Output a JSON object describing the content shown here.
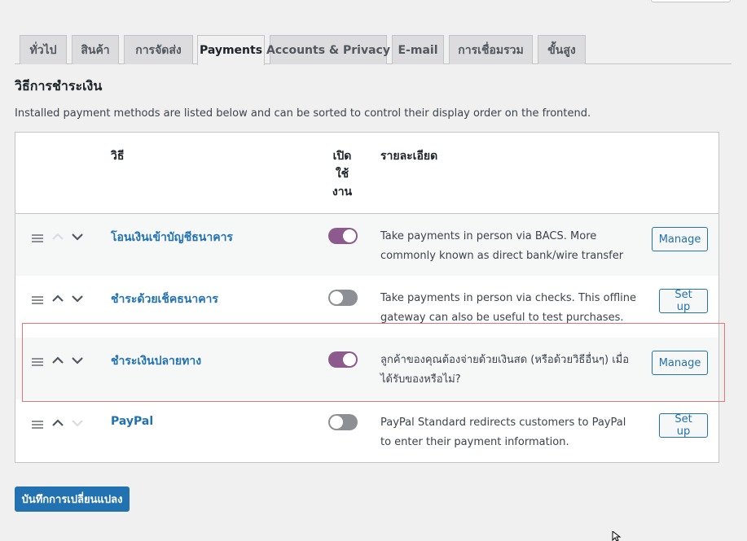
{
  "tabs": [
    {
      "label": "ทั่วไป",
      "active": false
    },
    {
      "label": "สินค้า",
      "active": false
    },
    {
      "label": "การจัดส่ง",
      "active": false
    },
    {
      "label": "Payments",
      "active": true
    },
    {
      "label": "Accounts & Privacy",
      "active": false
    },
    {
      "label": "E-mail",
      "active": false
    },
    {
      "label": "การเชื่อมรวม",
      "active": false
    },
    {
      "label": "ขั้นสูง",
      "active": false
    }
  ],
  "section_title": "วิธีการชำระเงิน",
  "intro_text": "Installed payment methods are listed below and can be sorted to control their display order on the frontend.",
  "table": {
    "headers": {
      "method": "วิธี",
      "enabled_line1": "เปิด",
      "enabled_line2": "ใช้",
      "enabled_line3": "งาน",
      "description": "รายละเอียด"
    },
    "rows": [
      {
        "name": "โอนเงินเข้าบัญชีธนาคาร",
        "enabled": true,
        "description": "Take payments in person via BACS. More commonly known as direct bank/wire transfer",
        "action": "Manage"
      },
      {
        "name": "ชำระด้วยเช็คธนาคาร",
        "enabled": false,
        "description": "Take payments in person via checks. This offline gateway can also be useful to test purchases.",
        "action": "Set up"
      },
      {
        "name": "ชำระเงินปลายทาง",
        "enabled": true,
        "description": "ลูกค้าของคุณต้องจ่ายด้วยเงินสด (หรือด้วยวิธีอื่นๆ) เมื่อได้รับของหรือไม่?",
        "action": "Manage"
      },
      {
        "name": "PayPal",
        "enabled": false,
        "description": "PayPal Standard redirects customers to PayPal to enter their payment information.",
        "action": "Set up"
      }
    ]
  },
  "save_button": "บันทึกการเปลี่ยนแปลง",
  "colors": {
    "accent": "#2271b1",
    "toggle_on": "#8c5a8c",
    "toggle_off": "#8c8f94",
    "highlight": "#e8737a"
  },
  "icons": [
    "drag-handle-icon",
    "chevron-up-icon",
    "chevron-down-icon",
    "mouse-cursor-icon"
  ]
}
